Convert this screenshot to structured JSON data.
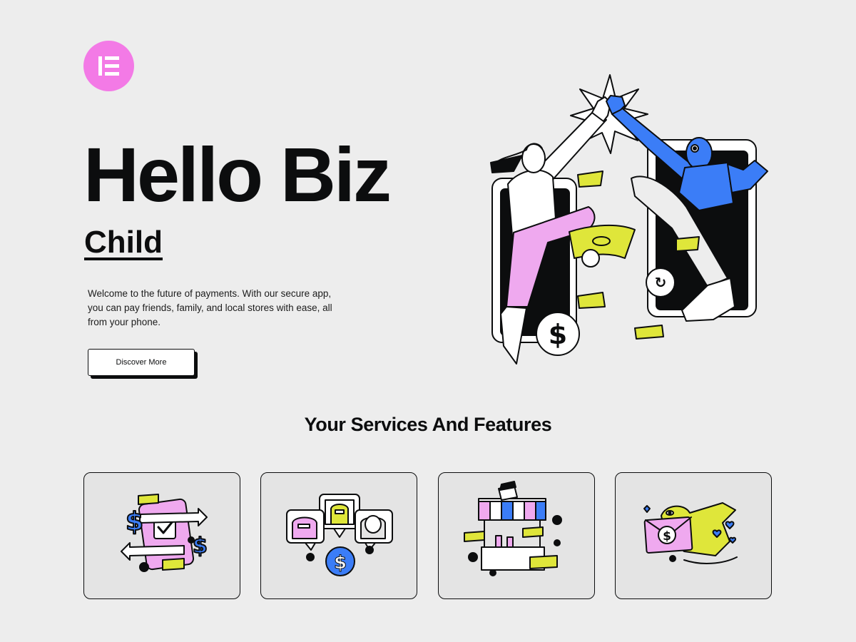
{
  "brand": {
    "logo_icon": "elementor-logo-icon",
    "accent": "#f37ae6"
  },
  "hero": {
    "title": "Hello Biz",
    "subtitle": "Child",
    "description": "Welcome to the future of payments. With our secure app, you can pay friends, family, and local stores with ease, all from your phone.",
    "cta_label": "Discover More",
    "illustration_icon": "high-five-phones-illustration"
  },
  "services": {
    "title": "Your Services And Features",
    "cards": [
      {
        "icon": "money-transfer-phone-icon"
      },
      {
        "icon": "group-payment-chat-icon"
      },
      {
        "icon": "market-stall-icon"
      },
      {
        "icon": "bird-envelope-icon"
      }
    ]
  },
  "colors": {
    "pink": "#efa9ef",
    "blue": "#3b7df7",
    "lime": "#dfe63a",
    "ink": "#0c0d0e",
    "background": "#ededed"
  }
}
